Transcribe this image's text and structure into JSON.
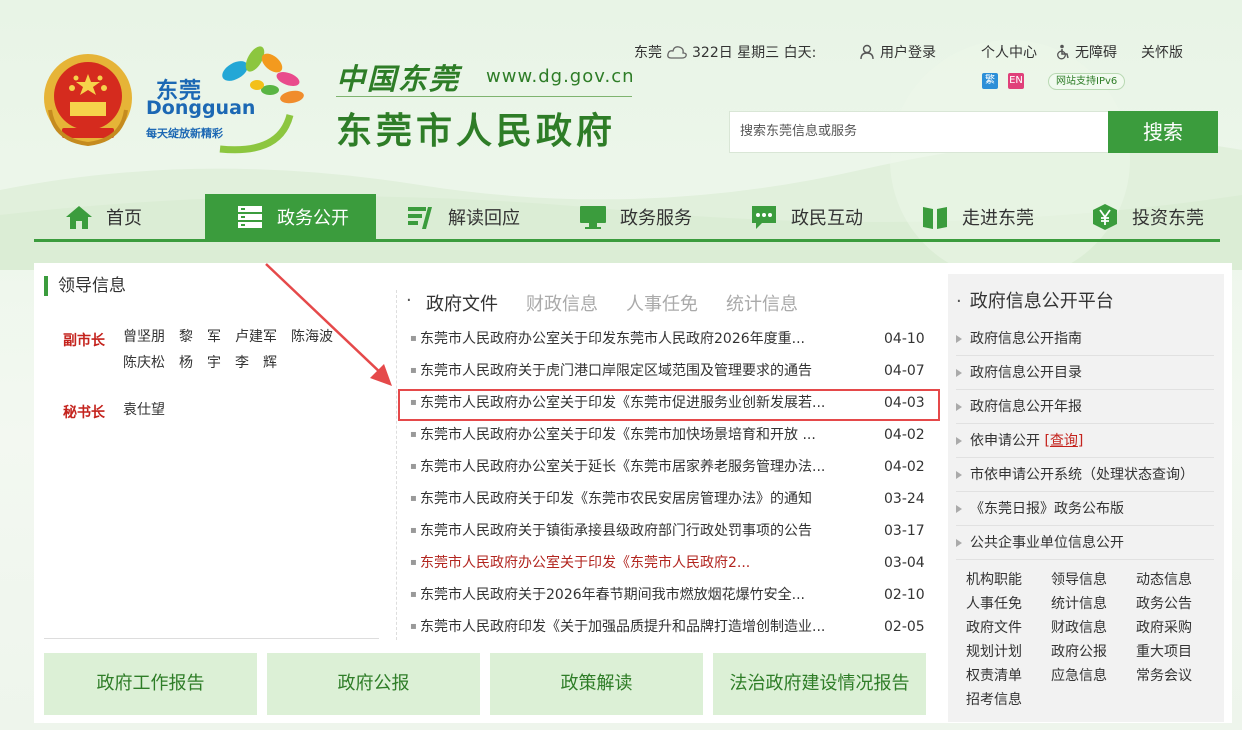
{
  "header": {
    "logo_cn": "东莞",
    "logo_en": "Dongguan",
    "logo_slogan": "每天绽放新精彩",
    "title_top": "中国东莞",
    "url": "www.dg.gov.cn",
    "title": "东莞市人民政府"
  },
  "topbar": {
    "city": "东莞",
    "weather": "322日 星期三 白天:",
    "login": "用户登录",
    "personal": "个人中心",
    "accessibility": "无障碍",
    "care": "关怀版",
    "lang_traditional": "繁",
    "lang_english": "EN",
    "ipv6": "网站支持IPv6"
  },
  "search": {
    "placeholder": "搜索东莞信息或服务",
    "button": "搜索"
  },
  "nav": {
    "items": [
      {
        "label": "首页",
        "icon": "home-icon"
      },
      {
        "label": "政务公开",
        "icon": "list-icon"
      },
      {
        "label": "解读回应",
        "icon": "interpret-icon"
      },
      {
        "label": "政务服务",
        "icon": "monitor-icon"
      },
      {
        "label": "政民互动",
        "icon": "chat-icon"
      },
      {
        "label": "走进东莞",
        "icon": "book-icon"
      },
      {
        "label": "投资东莞",
        "icon": "yen-icon"
      }
    ]
  },
  "leaders": {
    "title": "领导信息",
    "vice_mayor_label": "副市长",
    "vice_mayors": [
      "曾坚朋",
      "黎　军",
      "卢建军",
      "陈海波",
      "陈庆松",
      "杨　宇",
      "李　辉"
    ],
    "secretary_label": "秘书长",
    "secretary": [
      "袁仕望"
    ]
  },
  "tabs": [
    "政府文件",
    "财政信息",
    "人事任免",
    "统计信息"
  ],
  "news": [
    {
      "title": "东莞市人民政府办公室关于印发东莞市人民政府2026年度重...",
      "date": "04-10"
    },
    {
      "title": "东莞市人民政府关于虎门港口岸限定区域范围及管理要求的通告",
      "date": "04-07"
    },
    {
      "title": "东莞市人民政府办公室关于印发《东莞市促进服务业创新发展若...",
      "date": "04-03"
    },
    {
      "title": "东莞市人民政府办公室关于印发《东莞市加快场景培育和开放 ...",
      "date": "04-02"
    },
    {
      "title": "东莞市人民政府办公室关于延长《东莞市居家养老服务管理办法...",
      "date": "04-02"
    },
    {
      "title": "东莞市人民政府关于印发《东莞市农民安居房管理办法》的通知",
      "date": "03-24"
    },
    {
      "title": "东莞市人民政府关于镇街承接县级政府部门行政处罚事项的公告",
      "date": "03-17"
    },
    {
      "title": "东莞市人民政府办公室关于印发《东莞市人民政府2...",
      "date": "03-04"
    },
    {
      "title": "东莞市人民政府关于2026年春节期间我市燃放烟花爆竹安全...",
      "date": "02-10"
    },
    {
      "title": "东莞市人民政府印发《关于加强品质提升和品牌打造增创制造业...",
      "date": "02-05"
    }
  ],
  "platform": {
    "title": "政府信息公开平台",
    "links": [
      "政府信息公开指南",
      "政府信息公开目录",
      "政府信息公开年报",
      "依申请公开",
      "市依申请公开系统（处理状态查询）",
      "《东莞日报》政务公布版",
      "公共企事业单位信息公开"
    ],
    "query_link": "查询",
    "bracket_open": "[",
    "bracket_close": "]",
    "grid": [
      "机构职能",
      "领导信息",
      "动态信息",
      "人事任免",
      "统计信息",
      "政务公告",
      "政府文件",
      "财政信息",
      "政府采购",
      "规划计划",
      "政府公报",
      "重大项目",
      "权责清单",
      "应急信息",
      "常务会议",
      "招考信息"
    ]
  },
  "bottom_buttons": [
    "政府工作报告",
    "政府公报",
    "政策解读",
    "法治政府建设情况报告"
  ],
  "colors": {
    "primary_green": "#3b9c3d",
    "highlight_red": "#e5494a",
    "accent_red": "#c4231d"
  }
}
